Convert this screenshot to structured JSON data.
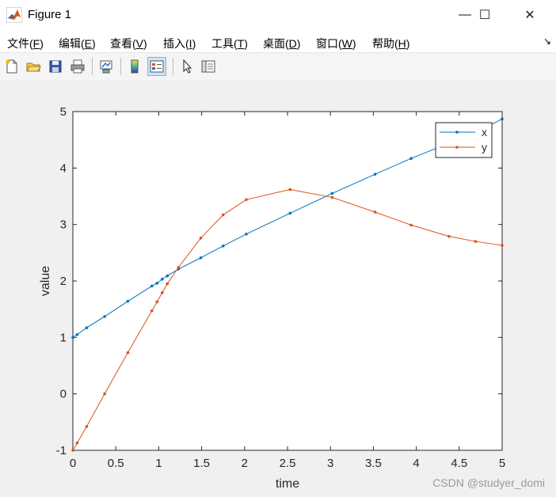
{
  "window": {
    "title": "Figure 1",
    "controls": {
      "minimize": "—",
      "maximize": "☐",
      "close": "✕"
    }
  },
  "menu": [
    {
      "label": "文件(",
      "acc": "F",
      "tail": ")"
    },
    {
      "label": "编辑(",
      "acc": "E",
      "tail": ")"
    },
    {
      "label": "查看(",
      "acc": "V",
      "tail": ")"
    },
    {
      "label": "插入(",
      "acc": "I",
      "tail": ")"
    },
    {
      "label": "工具(",
      "acc": "T",
      "tail": ")"
    },
    {
      "label": "桌面(",
      "acc": "D",
      "tail": ")"
    },
    {
      "label": "窗口(",
      "acc": "W",
      "tail": ")"
    },
    {
      "label": "帮助(",
      "acc": "H",
      "tail": ")"
    }
  ],
  "menu_arrow": "↘",
  "toolbar": {
    "icons": [
      "new-file-icon",
      "open-folder-icon",
      "save-icon",
      "print-icon",
      "link-plot-icon",
      "colorbar-icon",
      "legend-icon",
      "pointer-icon",
      "property-editor-icon"
    ]
  },
  "watermark": "CSDN @studyer_domi",
  "colors": {
    "x": "#0072BD",
    "y": "#D95319"
  },
  "chart_data": {
    "type": "line",
    "title": "",
    "xlabel": "time",
    "ylabel": "value",
    "xlim": [
      0,
      5
    ],
    "ylim": [
      -1,
      5
    ],
    "xticks": [
      "0",
      "0.5",
      "1",
      "1.5",
      "2",
      "2.5",
      "3",
      "3.5",
      "4",
      "4.5",
      "5"
    ],
    "yticks": [
      "-1",
      "0",
      "1",
      "2",
      "3",
      "4",
      "5"
    ],
    "grid": false,
    "legend": "top-right",
    "series": [
      {
        "name": "x",
        "color": "#0072BD",
        "x": [
          0,
          0.05,
          0.16,
          0.37,
          0.64,
          0.92,
          0.98,
          1.04,
          1.1,
          1.23,
          1.49,
          1.75,
          2.02,
          2.53,
          3.02,
          3.52,
          3.94,
          4.38,
          4.69,
          5.0
        ],
        "y": [
          1.0,
          1.05,
          1.17,
          1.37,
          1.64,
          1.91,
          1.96,
          2.03,
          2.09,
          2.21,
          2.41,
          2.62,
          2.83,
          3.2,
          3.55,
          3.89,
          4.17,
          4.44,
          4.63,
          4.87
        ]
      },
      {
        "name": "y",
        "color": "#D95319",
        "x": [
          0,
          0.05,
          0.16,
          0.37,
          0.64,
          0.92,
          0.98,
          1.04,
          1.1,
          1.23,
          1.49,
          1.75,
          2.02,
          2.53,
          3.02,
          3.52,
          3.94,
          4.38,
          4.69,
          5.0
        ],
        "y": [
          -1.0,
          -0.87,
          -0.58,
          0.0,
          0.73,
          1.47,
          1.63,
          1.79,
          1.95,
          2.24,
          2.76,
          3.17,
          3.44,
          3.62,
          3.48,
          3.22,
          2.99,
          2.79,
          2.7,
          2.63
        ]
      }
    ]
  }
}
